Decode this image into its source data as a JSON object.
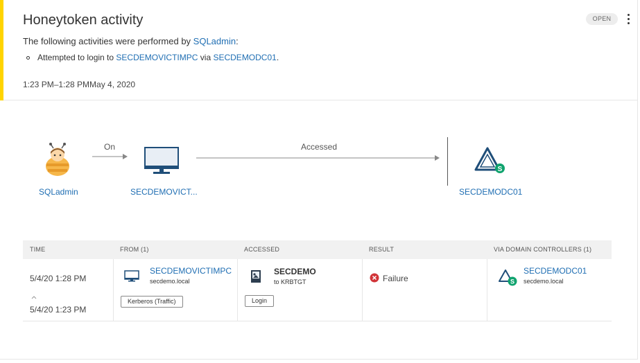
{
  "header": {
    "title": "Honeytoken activity",
    "status": "OPEN",
    "description_prefix": "The following activities were performed by ",
    "description_user": "SQLadmin",
    "description_suffix": ":",
    "bullet_prefix": "Attempted to login to ",
    "bullet_target": "SECDEMOVICTIMPC",
    "bullet_via": " via ",
    "bullet_dc": "SECDEMODC01",
    "bullet_end": ".",
    "time_range": "1:23 PM–1:28 PMMay 4, 2020"
  },
  "diagram": {
    "source_label": "SQLadmin",
    "edge1_label": "On",
    "device_label": "SECDEMOVICT...",
    "edge2_label": "Accessed",
    "dc_label": "SECDEMODC01",
    "dc_badge": "S"
  },
  "table": {
    "headers": [
      "TIME",
      "FROM (1)",
      "ACCESSED",
      "RESULT",
      "VIA DOMAIN CONTROLLERS (1)"
    ],
    "row": {
      "time_end": "5/4/20 1:28 PM",
      "time_start": "5/4/20 1:23 PM",
      "from_name": "SECDEMOVICTIMPC",
      "from_domain": "secdemo.local",
      "from_protocol": "Kerberos (Traffic)",
      "accessed_name": "SECDEMO",
      "accessed_sub": "to KRBTGT",
      "accessed_action": "Login",
      "result": "Failure",
      "dc_name": "SECDEMODC01",
      "dc_domain": "secdemo.local",
      "dc_badge": "S"
    }
  },
  "colors": {
    "accent": "#ffd400",
    "link": "#1f6eb3",
    "failure": "#d13438",
    "dc_badge": "#10a36e",
    "monitor_blue": "#1f4e79"
  },
  "icons": {
    "user": "honeybee-user-icon",
    "device": "monitor-icon",
    "dc": "domain-controller-icon",
    "accessed": "resource-icon",
    "result": "failure-icon",
    "time_arrow": "chevron-up-icon"
  }
}
